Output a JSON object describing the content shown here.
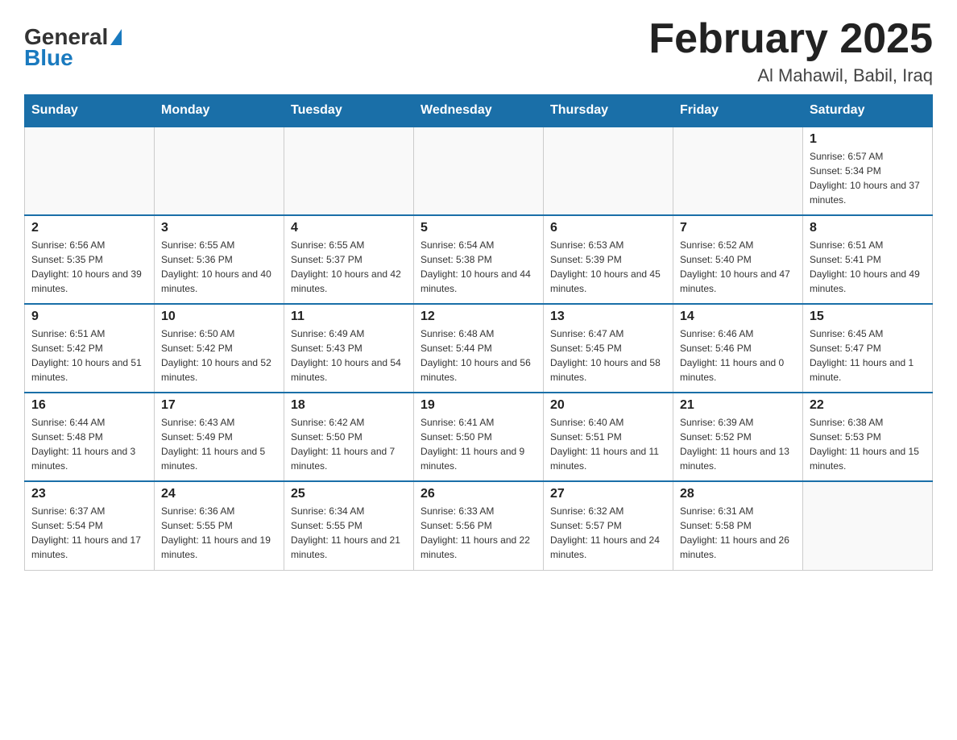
{
  "header": {
    "logo_general": "General",
    "logo_blue": "Blue",
    "month_title": "February 2025",
    "location": "Al Mahawil, Babil, Iraq"
  },
  "days_of_week": [
    "Sunday",
    "Monday",
    "Tuesday",
    "Wednesday",
    "Thursday",
    "Friday",
    "Saturday"
  ],
  "weeks": [
    [
      {
        "day": "",
        "info": ""
      },
      {
        "day": "",
        "info": ""
      },
      {
        "day": "",
        "info": ""
      },
      {
        "day": "",
        "info": ""
      },
      {
        "day": "",
        "info": ""
      },
      {
        "day": "",
        "info": ""
      },
      {
        "day": "1",
        "info": "Sunrise: 6:57 AM\nSunset: 5:34 PM\nDaylight: 10 hours and 37 minutes."
      }
    ],
    [
      {
        "day": "2",
        "info": "Sunrise: 6:56 AM\nSunset: 5:35 PM\nDaylight: 10 hours and 39 minutes."
      },
      {
        "day": "3",
        "info": "Sunrise: 6:55 AM\nSunset: 5:36 PM\nDaylight: 10 hours and 40 minutes."
      },
      {
        "day": "4",
        "info": "Sunrise: 6:55 AM\nSunset: 5:37 PM\nDaylight: 10 hours and 42 minutes."
      },
      {
        "day": "5",
        "info": "Sunrise: 6:54 AM\nSunset: 5:38 PM\nDaylight: 10 hours and 44 minutes."
      },
      {
        "day": "6",
        "info": "Sunrise: 6:53 AM\nSunset: 5:39 PM\nDaylight: 10 hours and 45 minutes."
      },
      {
        "day": "7",
        "info": "Sunrise: 6:52 AM\nSunset: 5:40 PM\nDaylight: 10 hours and 47 minutes."
      },
      {
        "day": "8",
        "info": "Sunrise: 6:51 AM\nSunset: 5:41 PM\nDaylight: 10 hours and 49 minutes."
      }
    ],
    [
      {
        "day": "9",
        "info": "Sunrise: 6:51 AM\nSunset: 5:42 PM\nDaylight: 10 hours and 51 minutes."
      },
      {
        "day": "10",
        "info": "Sunrise: 6:50 AM\nSunset: 5:42 PM\nDaylight: 10 hours and 52 minutes."
      },
      {
        "day": "11",
        "info": "Sunrise: 6:49 AM\nSunset: 5:43 PM\nDaylight: 10 hours and 54 minutes."
      },
      {
        "day": "12",
        "info": "Sunrise: 6:48 AM\nSunset: 5:44 PM\nDaylight: 10 hours and 56 minutes."
      },
      {
        "day": "13",
        "info": "Sunrise: 6:47 AM\nSunset: 5:45 PM\nDaylight: 10 hours and 58 minutes."
      },
      {
        "day": "14",
        "info": "Sunrise: 6:46 AM\nSunset: 5:46 PM\nDaylight: 11 hours and 0 minutes."
      },
      {
        "day": "15",
        "info": "Sunrise: 6:45 AM\nSunset: 5:47 PM\nDaylight: 11 hours and 1 minute."
      }
    ],
    [
      {
        "day": "16",
        "info": "Sunrise: 6:44 AM\nSunset: 5:48 PM\nDaylight: 11 hours and 3 minutes."
      },
      {
        "day": "17",
        "info": "Sunrise: 6:43 AM\nSunset: 5:49 PM\nDaylight: 11 hours and 5 minutes."
      },
      {
        "day": "18",
        "info": "Sunrise: 6:42 AM\nSunset: 5:50 PM\nDaylight: 11 hours and 7 minutes."
      },
      {
        "day": "19",
        "info": "Sunrise: 6:41 AM\nSunset: 5:50 PM\nDaylight: 11 hours and 9 minutes."
      },
      {
        "day": "20",
        "info": "Sunrise: 6:40 AM\nSunset: 5:51 PM\nDaylight: 11 hours and 11 minutes."
      },
      {
        "day": "21",
        "info": "Sunrise: 6:39 AM\nSunset: 5:52 PM\nDaylight: 11 hours and 13 minutes."
      },
      {
        "day": "22",
        "info": "Sunrise: 6:38 AM\nSunset: 5:53 PM\nDaylight: 11 hours and 15 minutes."
      }
    ],
    [
      {
        "day": "23",
        "info": "Sunrise: 6:37 AM\nSunset: 5:54 PM\nDaylight: 11 hours and 17 minutes."
      },
      {
        "day": "24",
        "info": "Sunrise: 6:36 AM\nSunset: 5:55 PM\nDaylight: 11 hours and 19 minutes."
      },
      {
        "day": "25",
        "info": "Sunrise: 6:34 AM\nSunset: 5:55 PM\nDaylight: 11 hours and 21 minutes."
      },
      {
        "day": "26",
        "info": "Sunrise: 6:33 AM\nSunset: 5:56 PM\nDaylight: 11 hours and 22 minutes."
      },
      {
        "day": "27",
        "info": "Sunrise: 6:32 AM\nSunset: 5:57 PM\nDaylight: 11 hours and 24 minutes."
      },
      {
        "day": "28",
        "info": "Sunrise: 6:31 AM\nSunset: 5:58 PM\nDaylight: 11 hours and 26 minutes."
      },
      {
        "day": "",
        "info": ""
      }
    ]
  ]
}
